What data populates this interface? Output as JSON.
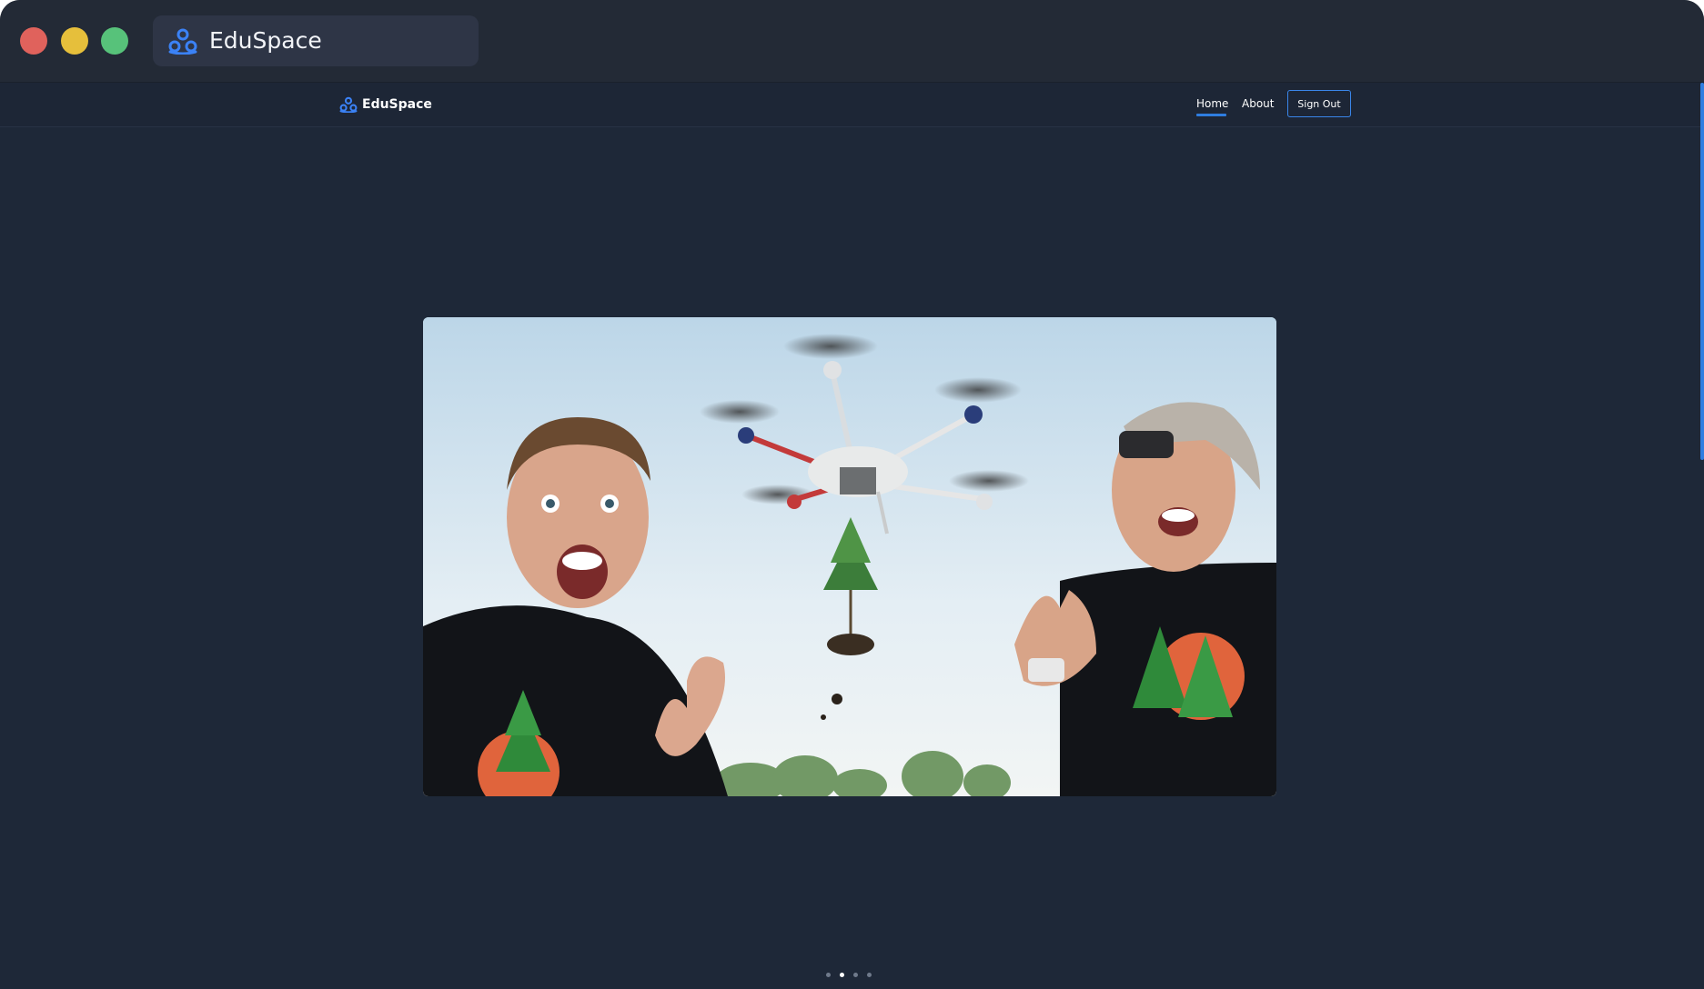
{
  "window": {
    "tab_title": "EduSpace",
    "tab_icon": "eduspace-logo-icon"
  },
  "navbar": {
    "brand": "EduSpace",
    "brand_icon": "eduspace-logo-icon",
    "links": [
      {
        "label": "Home",
        "active": true
      },
      {
        "label": "About",
        "active": false
      }
    ],
    "sign_out_label": "Sign Out"
  },
  "carousel": {
    "slide_count": 4,
    "active_index": 1
  },
  "colors": {
    "accent": "#2f7de0",
    "background": "#1e2838",
    "navbar": "#1d2636",
    "titlebar": "#232a36"
  }
}
